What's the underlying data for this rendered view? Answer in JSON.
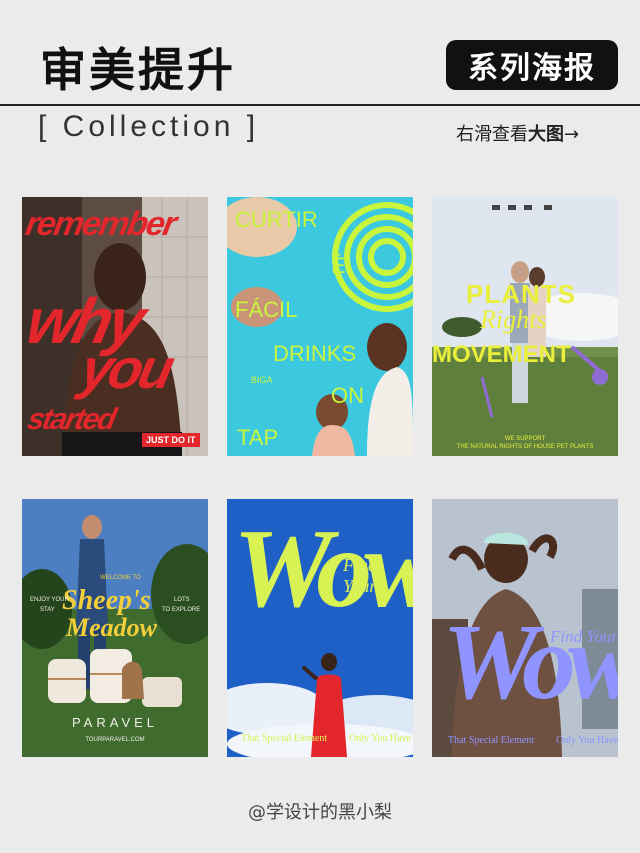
{
  "header": {
    "title": "审美提升",
    "badge": "系列海报",
    "collection": "[ Collection ]",
    "swipe_prefix": "右滑查看",
    "swipe_bold": "大图",
    "swipe_arrow": "→"
  },
  "posters": [
    {
      "id": "remember",
      "texts": [
        "remember",
        "why",
        "you",
        "started",
        "JUST DO IT"
      ]
    },
    {
      "id": "curtir",
      "texts": [
        "CURTIR",
        "É",
        "FÁCIL",
        "DRINKS",
        "ON",
        "TAP",
        "BIGA"
      ]
    },
    {
      "id": "plants",
      "texts": [
        "PLANTS",
        "Rights",
        "MOVEMENT",
        "WE SUPPORT",
        "THE NATURAL RIGHTS OF HOUSE PET PLANTS"
      ]
    },
    {
      "id": "sheeps",
      "texts": [
        "WELCOME TO",
        "Sheep's",
        "Meadow",
        "ENJOY YOUR",
        "STAY",
        "LOTS",
        "TO EXPLORE",
        "PARAVEL",
        "TOURPARAVEL.COM"
      ]
    },
    {
      "id": "wow-red",
      "texts": [
        "Wow",
        "Find Your",
        "That Special Element",
        "Only You Have"
      ]
    },
    {
      "id": "wow-purple",
      "texts": [
        "Wow",
        "Find Your",
        "That Special Element",
        "Only You Have"
      ]
    }
  ],
  "footer": {
    "credit": "@学设计的黑小梨"
  },
  "colors": {
    "background": "#ebebeb",
    "remember_red": "#e3262b",
    "curtir_cyan": "#3cc9e0",
    "curtir_lime": "#c9f53c",
    "plants_yellow": "#e9ef3a",
    "wow_lime": "#d8f254",
    "wow_purple": "#8f94ff"
  }
}
